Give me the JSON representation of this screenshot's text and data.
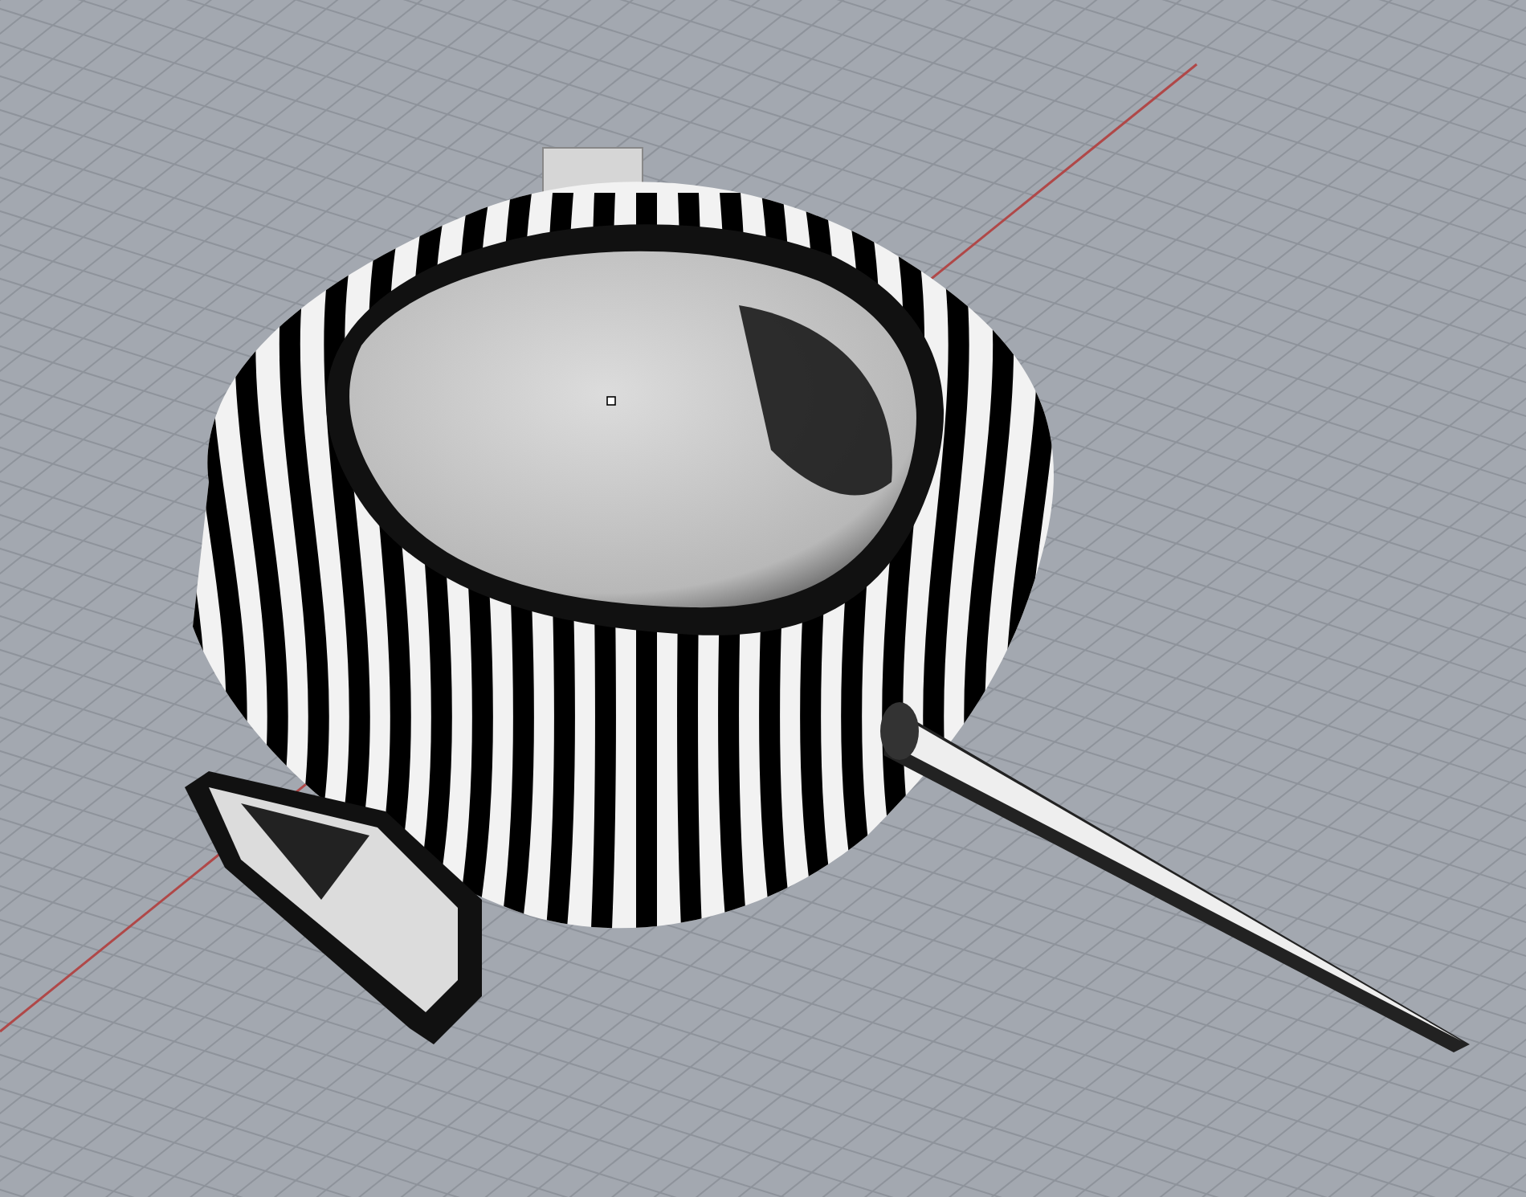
{
  "viewport": {
    "grid_visible": true,
    "x_axis_visible": true
  }
}
